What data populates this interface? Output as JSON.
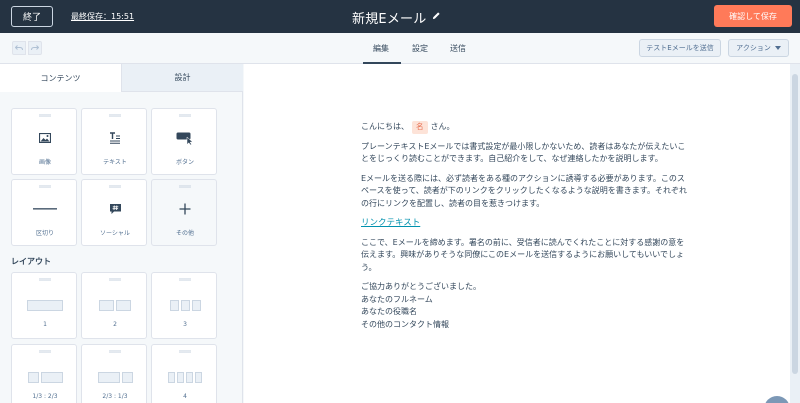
{
  "header": {
    "exit_label": "終了",
    "last_saved": "最終保存：15:51",
    "title": "新規Eメール",
    "save_label": "確認して保存"
  },
  "toolbar": {
    "tabs": [
      "編集",
      "設定",
      "送信"
    ],
    "test_email_label": "テストEメールを送信",
    "actions_label": "アクション"
  },
  "left_panel": {
    "tabs": [
      "コンテンツ",
      "設計"
    ],
    "modules": [
      {
        "label": "画像",
        "icon": "image-icon"
      },
      {
        "label": "テキスト",
        "icon": "text-icon"
      },
      {
        "label": "ボタン",
        "icon": "button-icon"
      },
      {
        "label": "区切り",
        "icon": "divider-icon"
      },
      {
        "label": "ソーシャル",
        "icon": "social-icon"
      },
      {
        "label": "その他",
        "icon": "plus-icon"
      }
    ],
    "layout_heading": "レイアウト",
    "layouts": [
      {
        "label": "1",
        "cols": [
          1
        ]
      },
      {
        "label": "2",
        "cols": [
          1,
          1
        ]
      },
      {
        "label": "3",
        "cols": [
          1,
          1,
          1
        ]
      },
      {
        "label": "1/3 : 2/3",
        "cols": [
          1,
          2
        ]
      },
      {
        "label": "2/3 : 1/3",
        "cols": [
          2,
          1
        ]
      },
      {
        "label": "4",
        "cols": [
          1,
          1,
          1,
          1
        ]
      }
    ]
  },
  "email": {
    "greeting_prefix": "こんにちは、",
    "name_token": "名",
    "greeting_suffix": "さん。",
    "paragraph1": "プレーンテキストEメールでは書式設定が最小限しかないため、読者はあなたが伝えたいことをじっくり読むことができます。自己紹介をして、なぜ連絡したかを説明します。",
    "paragraph2": "Eメールを送る際には、必ず読者をある種のアクションに誘導する必要があります。このスペースを使って、読者が下のリンクをクリックしたくなるような説明を書きます。それぞれの行にリンクを配置し、読者の目を惹きつけます。",
    "link_text": "リンクテキスト",
    "paragraph3": "ここで、Eメールを締めます。署名の前に、受信者に読んでくれたことに対する感謝の意を伝えます。興味がありそうな同僚にこのEメールを送信するようにお願いしてもいいでしょう。",
    "closing": [
      "ご協力ありがとうございました。",
      "あなたのフルネーム",
      "あなたの役職名",
      "その他のコンタクト情報"
    ]
  },
  "colors": {
    "header_bg": "#253342",
    "accent": "#ff7a59",
    "link": "#0091ae",
    "token_bg": "#fde3d8"
  }
}
